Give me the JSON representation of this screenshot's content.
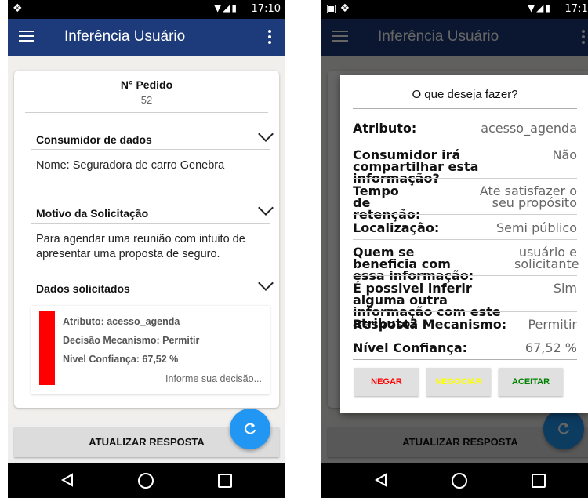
{
  "status_bar": {
    "time": "17:10"
  },
  "app": {
    "title": "Inferência Usuário"
  },
  "pedido": {
    "label": "N° Pedido",
    "number": "52"
  },
  "sections": {
    "consumidor": {
      "title": "Consumidor de dados",
      "text": "Nome: Seguradora de carro Genebra"
    },
    "motivo": {
      "title": "Motivo da Solicitação",
      "text": "Para agendar uma reunião com intuito de apresentar uma proposta de seguro."
    },
    "dados": {
      "title": "Dados solicitados"
    }
  },
  "request_item": {
    "atributo": "Atributo: acesso_agenda",
    "decisao": "Decisão Mecanismo: Permitir",
    "confianca": "Nivel Confiança: 67,52 %",
    "inform": "Informe sua decisão...",
    "bar_color": "#ff0000"
  },
  "update_button": "ATUALIZAR RESPOSTA",
  "colors": {
    "toolbar": "#1d3b7a",
    "fab": "#2196f3",
    "nao": "#ff0000",
    "negociar": "#ffff00",
    "aceitar": "#008000"
  },
  "icons": {
    "menu": "menu-icon",
    "more": "more-vert-icon",
    "chevron": "chevron-down-icon",
    "refresh": "refresh-icon",
    "back": "back-icon",
    "home": "home-icon",
    "recent": "recent-apps-icon"
  },
  "dialog": {
    "title": "O que deseja fazer?",
    "rows": [
      {
        "label": "Atributo:",
        "value": "acesso_agenda"
      },
      {
        "label": "Consumidor irá compartilhar esta informação?",
        "value": "Não"
      },
      {
        "label": "Tempo de retenção:",
        "value": "Ate satisfazer o seu propósito"
      },
      {
        "label": "Localização:",
        "value": "Semi público"
      },
      {
        "label": "Quem se beneficia com essa informação:",
        "value": "usuário e solicitante"
      },
      {
        "label": "É possivel inferir alguma outra informação com este atributo?",
        "value": "Sim"
      },
      {
        "label": "Resposta Mecanismo:",
        "value": "Permitir"
      },
      {
        "label": "Nível Confiança:",
        "value": "67,52 %"
      }
    ],
    "buttons": {
      "negar": "NEGAR",
      "negociar": "NEGOCIAR",
      "aceitar": "ACEITAR"
    }
  }
}
